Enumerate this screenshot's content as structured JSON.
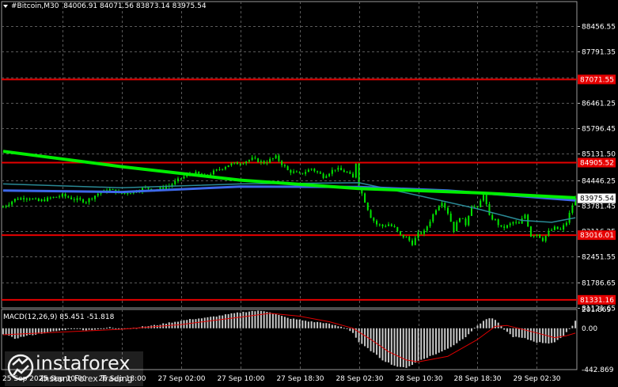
{
  "header": {
    "symbol": "#Bitcoin,M30",
    "ohlc": "84006.91 84071.56 83873.14 83975.54"
  },
  "macd_label": "MACD(12,26,9) 85.451 -51.818",
  "watermark": {
    "brand": "instaforex",
    "tagline": "Instant Forex Trading"
  },
  "colors": {
    "background": "#000000",
    "grid": "#5a5a5a",
    "candle": "#00e600",
    "ma_fast": "#00ee00",
    "ma_mid": "#3d68e8",
    "ma_slow": "#2a8a96",
    "level_line": "#e60000",
    "current_price_bg": "#ffffff",
    "histogram": "#c8c8c8",
    "signal": "#e00000",
    "axis_text": "#ffffff"
  },
  "chart_data": {
    "type": "candlestick",
    "timeframe": "M30",
    "ylim": [
      81121.65,
      89100
    ],
    "y_ticks": [
      "88456.55",
      "87791.35",
      "87126.15",
      "86461.25",
      "85796.45",
      "85131.50",
      "84446.25",
      "83781.45",
      "83116.25",
      "82451.55",
      "81786.65",
      "81121.65"
    ],
    "x_labels": [
      {
        "label": "25 Sep 2025",
        "bar": 0
      },
      {
        "label": "25 Sep 10:00",
        "bar": 20
      },
      {
        "label": "26 Sep 18:00",
        "bar": 40
      },
      {
        "label": "27 Sep 02:00",
        "bar": 60
      },
      {
        "label": "27 Sep 10:00",
        "bar": 80
      },
      {
        "label": "27 Sep 18:30",
        "bar": 100
      },
      {
        "label": "28 Sep 02:30",
        "bar": 120
      },
      {
        "label": "28 Sep 10:30",
        "bar": 140
      },
      {
        "label": "28 Sep 18:30",
        "bar": 160
      },
      {
        "label": "29 Sep 02:30",
        "bar": 180
      }
    ],
    "close_path": [
      [
        0,
        83750
      ],
      [
        4,
        83950
      ],
      [
        8,
        84000
      ],
      [
        12,
        83900
      ],
      [
        16,
        83980
      ],
      [
        20,
        84050
      ],
      [
        24,
        83950
      ],
      [
        28,
        83900
      ],
      [
        32,
        84100
      ],
      [
        36,
        84200
      ],
      [
        40,
        84100
      ],
      [
        44,
        84150
      ],
      [
        48,
        84250
      ],
      [
        52,
        84200
      ],
      [
        56,
        84300
      ],
      [
        60,
        84500
      ],
      [
        64,
        84650
      ],
      [
        68,
        84550
      ],
      [
        72,
        84700
      ],
      [
        76,
        84850
      ],
      [
        80,
        84900
      ],
      [
        84,
        85000
      ],
      [
        88,
        84900
      ],
      [
        92,
        85050
      ],
      [
        96,
        84700
      ],
      [
        100,
        84600
      ],
      [
        104,
        84750
      ],
      [
        108,
        84550
      ],
      [
        112,
        84750
      ],
      [
        116,
        84650
      ],
      [
        118,
        84500
      ],
      [
        119,
        84900
      ],
      [
        120,
        84300
      ],
      [
        122,
        83900
      ],
      [
        124,
        83500
      ],
      [
        126,
        83300
      ],
      [
        128,
        83250
      ],
      [
        130,
        83300
      ],
      [
        132,
        83200
      ],
      [
        134,
        83000
      ],
      [
        136,
        82950
      ],
      [
        138,
        82800
      ],
      [
        140,
        83050
      ],
      [
        142,
        83100
      ],
      [
        144,
        83400
      ],
      [
        146,
        83700
      ],
      [
        148,
        83900
      ],
      [
        150,
        83600
      ],
      [
        152,
        83150
      ],
      [
        154,
        83500
      ],
      [
        156,
        83300
      ],
      [
        158,
        83800
      ],
      [
        160,
        83700
      ],
      [
        162,
        84100
      ],
      [
        164,
        83500
      ],
      [
        166,
        83400
      ],
      [
        168,
        83200
      ],
      [
        170,
        83250
      ],
      [
        172,
        83350
      ],
      [
        174,
        83300
      ],
      [
        176,
        83550
      ],
      [
        178,
        83000
      ],
      [
        180,
        83050
      ],
      [
        182,
        82900
      ],
      [
        184,
        83100
      ],
      [
        186,
        83200
      ],
      [
        188,
        83150
      ],
      [
        190,
        83350
      ],
      [
        192,
        83800
      ],
      [
        193,
        83975.54
      ]
    ],
    "ma_fast": [
      [
        0,
        85200
      ],
      [
        40,
        84800
      ],
      [
        80,
        84450
      ],
      [
        120,
        84230
      ],
      [
        160,
        84120
      ],
      [
        193,
        83990
      ]
    ],
    "ma_mid": [
      [
        0,
        84180
      ],
      [
        40,
        84140
      ],
      [
        80,
        84280
      ],
      [
        120,
        84270
      ],
      [
        150,
        84180
      ],
      [
        170,
        84060
      ],
      [
        193,
        83920
      ]
    ],
    "ma_slow": [
      [
        0,
        84350
      ],
      [
        40,
        84250
      ],
      [
        80,
        84350
      ],
      [
        120,
        84380
      ],
      [
        140,
        84050
      ],
      [
        160,
        83700
      ],
      [
        175,
        83400
      ],
      [
        185,
        83350
      ],
      [
        193,
        83470
      ]
    ],
    "levels": [
      {
        "label": "87071.55",
        "value": 87071.55
      },
      {
        "label": "84905.52",
        "value": 84905.52
      },
      {
        "label": "83016.01",
        "value": 83016.01
      },
      {
        "label": "81331.16",
        "value": 81331.16
      }
    ],
    "current_price": {
      "label": "83975.54",
      "value": 83975.54
    },
    "macd": {
      "ylim": [
        -442.869,
        201.869
      ],
      "y_ticks": [
        "201.869",
        "0.00",
        "-442.869"
      ],
      "histogram_path": [
        [
          0,
          -60
        ],
        [
          4,
          -110
        ],
        [
          8,
          -80
        ],
        [
          12,
          -60
        ],
        [
          16,
          -40
        ],
        [
          20,
          -20
        ],
        [
          24,
          0
        ],
        [
          28,
          -20
        ],
        [
          32,
          -10
        ],
        [
          36,
          10
        ],
        [
          40,
          -5
        ],
        [
          44,
          5
        ],
        [
          48,
          20
        ],
        [
          52,
          35
        ],
        [
          56,
          60
        ],
        [
          60,
          80
        ],
        [
          64,
          100
        ],
        [
          68,
          110
        ],
        [
          72,
          130
        ],
        [
          76,
          150
        ],
        [
          80,
          170
        ],
        [
          84,
          185
        ],
        [
          88,
          185
        ],
        [
          90,
          175
        ],
        [
          92,
          150
        ],
        [
          96,
          110
        ],
        [
          100,
          90
        ],
        [
          104,
          70
        ],
        [
          108,
          60
        ],
        [
          112,
          30
        ],
        [
          116,
          0
        ],
        [
          118,
          -50
        ],
        [
          120,
          -150
        ],
        [
          124,
          -240
        ],
        [
          128,
          -340
        ],
        [
          132,
          -400
        ],
        [
          134,
          -420
        ],
        [
          136,
          -420
        ],
        [
          138,
          -390
        ],
        [
          140,
          -350
        ],
        [
          144,
          -300
        ],
        [
          148,
          -250
        ],
        [
          152,
          -180
        ],
        [
          156,
          -90
        ],
        [
          160,
          30
        ],
        [
          162,
          80
        ],
        [
          164,
          110
        ],
        [
          166,
          90
        ],
        [
          168,
          20
        ],
        [
          170,
          -40
        ],
        [
          172,
          -90
        ],
        [
          176,
          -110
        ],
        [
          180,
          -150
        ],
        [
          184,
          -160
        ],
        [
          186,
          -150
        ],
        [
          188,
          -110
        ],
        [
          190,
          -40
        ],
        [
          192,
          30
        ],
        [
          193,
          85.451
        ]
      ],
      "signal_path": [
        [
          0,
          -70
        ],
        [
          20,
          -40
        ],
        [
          40,
          -10
        ],
        [
          60,
          40
        ],
        [
          80,
          120
        ],
        [
          90,
          160
        ],
        [
          100,
          130
        ],
        [
          110,
          70
        ],
        [
          118,
          0
        ],
        [
          124,
          -120
        ],
        [
          130,
          -250
        ],
        [
          136,
          -340
        ],
        [
          140,
          -360
        ],
        [
          150,
          -300
        ],
        [
          160,
          -120
        ],
        [
          166,
          20
        ],
        [
          170,
          30
        ],
        [
          180,
          -50
        ],
        [
          186,
          -100
        ],
        [
          190,
          -80
        ],
        [
          193,
          -51.818
        ]
      ]
    }
  }
}
